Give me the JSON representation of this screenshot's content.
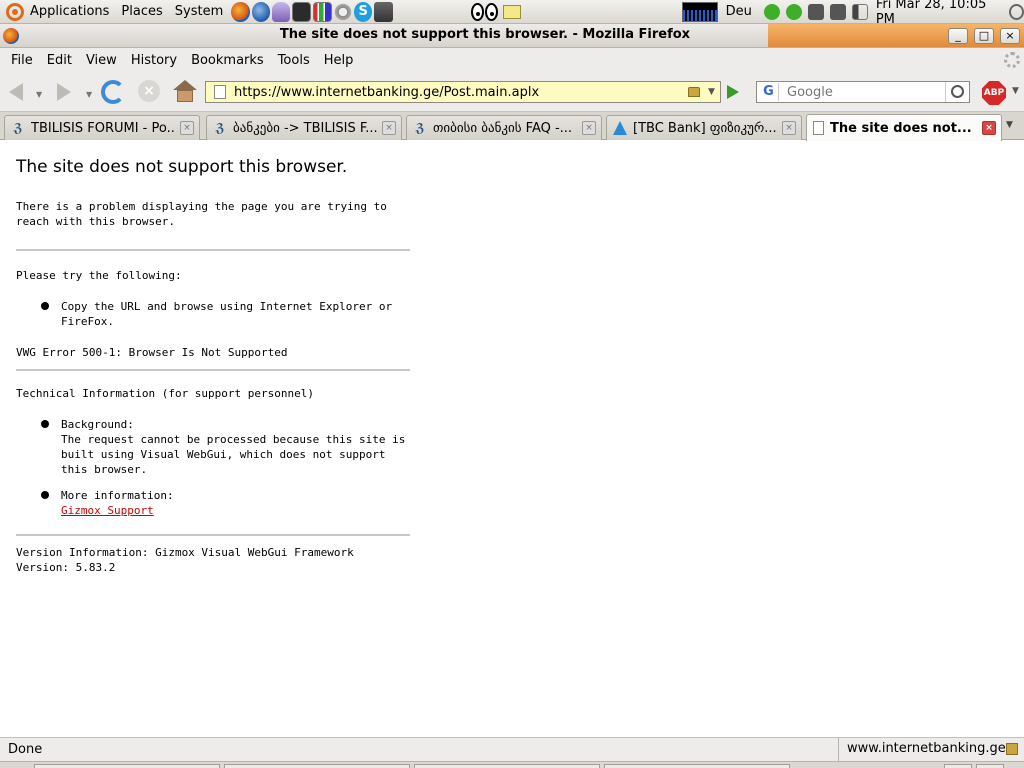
{
  "panel": {
    "menus": [
      "Applications",
      "Places",
      "System"
    ],
    "keyboard_layout": "Deu",
    "clock": "Fri Mar 28, 10:05 PM"
  },
  "window": {
    "title": "The site does not support this browser. - Mozilla Firefox"
  },
  "menubar": {
    "items": [
      "File",
      "Edit",
      "View",
      "History",
      "Bookmarks",
      "Tools",
      "Help"
    ]
  },
  "navbar": {
    "url": "https://www.internetbanking.ge/Post.main.aplx",
    "search_placeholder": "Google",
    "adblock_label": "ABP"
  },
  "tabs": [
    {
      "label": "TBILISIS FORUMI - Po...",
      "icon": "forum-favicon"
    },
    {
      "label": "ბანკები -> TBILISIS F...",
      "icon": "forum-favicon"
    },
    {
      "label": "თიბისი ბანკის FAQ -...",
      "icon": "forum-favicon"
    },
    {
      "label": "[TBC Bank] ფიზიკურ...",
      "icon": "tbc-favicon"
    },
    {
      "label": "The site does not...",
      "icon": "page-icon",
      "active": true
    }
  ],
  "content": {
    "heading": "The site does not support this browser.",
    "intro": "There is a problem displaying the page you are trying to reach with this browser.",
    "try_heading": "Please try the following:",
    "try_item": "Copy the URL and browse using Internet Explorer or FireFox.",
    "error": "VWG Error 500-1: Browser Is Not Supported",
    "tech_heading": "Technical Information (for support personnel)",
    "background_label": "Background:",
    "background_text": "The request cannot be processed because this site is built using Visual WebGui, which does not support this browser.",
    "more_label": "More information:",
    "more_link": "Gizmox Support",
    "version": "Version Information: Gizmox Visual WebGui Framework Version: 5.83.2"
  },
  "status": {
    "left": "Done",
    "right": "www.internetbanking.ge"
  }
}
